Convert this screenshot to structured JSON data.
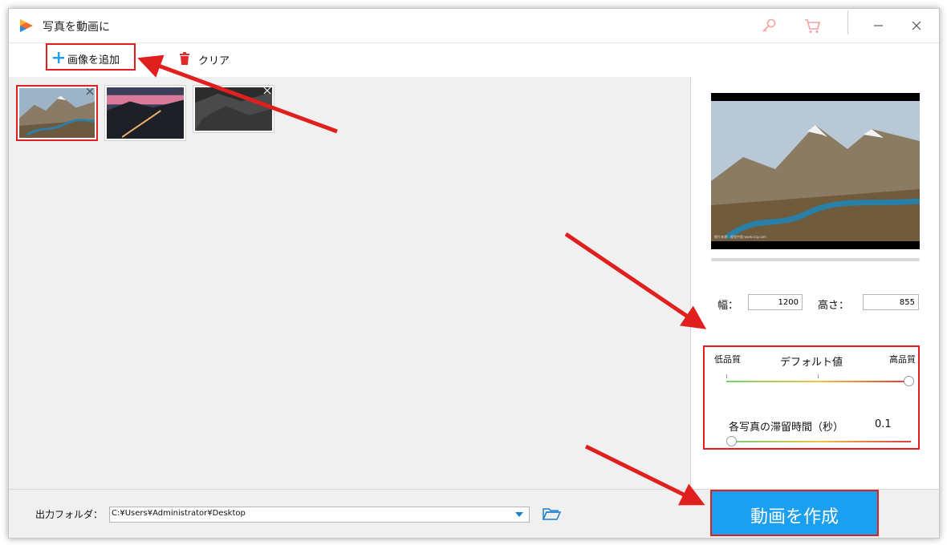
{
  "window": {
    "title": "写真を動画に"
  },
  "toolbar": {
    "add_image_label": "画像を追加",
    "clear_label": "クリア"
  },
  "image_list": {
    "thumbnails": [
      {
        "name": "mountain-river",
        "selected": true
      },
      {
        "name": "road-sunset",
        "selected": false
      },
      {
        "name": "rocky-terrain",
        "selected": false
      }
    ]
  },
  "preview": {
    "width_label": "幅：",
    "width_value": "1200",
    "height_label": "高さ：",
    "height_value": "855",
    "caption": "图片来源：视觉中国 www.vcg.com"
  },
  "quality": {
    "low_label": "低品質",
    "default_label": "デフォルト値",
    "high_label": "高品質",
    "level": 1.0,
    "duration_label": "各写真の滞留時間（秒）",
    "duration_value": "0.1"
  },
  "output": {
    "label": "出力フォルダ：",
    "path": "C:¥Users¥Administrator¥Desktop"
  },
  "actions": {
    "create_video_label": "動画を作成"
  },
  "colors": {
    "accent_blue": "#1a9ff1",
    "highlight_red": "#e0201f",
    "trash_red": "#e02a2a"
  },
  "icons": [
    "app-logo-icon",
    "key-icon",
    "cart-icon",
    "minimize-icon",
    "close-icon",
    "plus-icon",
    "trash-icon",
    "thumbnail-close-icon",
    "chevron-down-icon",
    "folder-open-icon"
  ]
}
